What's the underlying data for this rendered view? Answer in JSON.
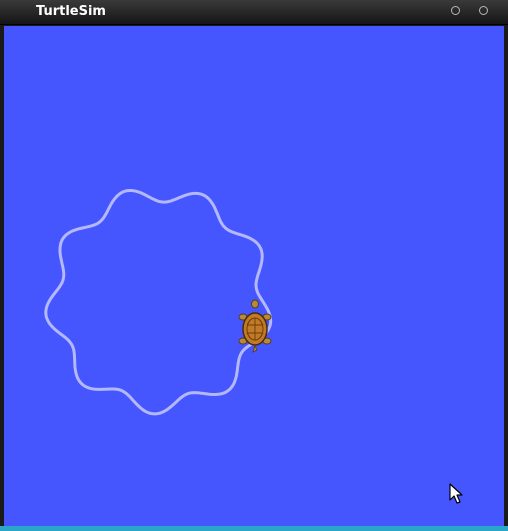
{
  "window": {
    "title": "TurtleSim"
  },
  "colors": {
    "canvas_background": "#4556ff",
    "trail": "#b3b8ff",
    "turtle_shell": "#c27a26",
    "turtle_skin": "#b58a3c"
  },
  "icons": {
    "turtle": "turtle-icon",
    "cursor": "mouse-pointer-icon",
    "window_control_1": "circle-icon",
    "window_control_2": "circle-icon"
  }
}
